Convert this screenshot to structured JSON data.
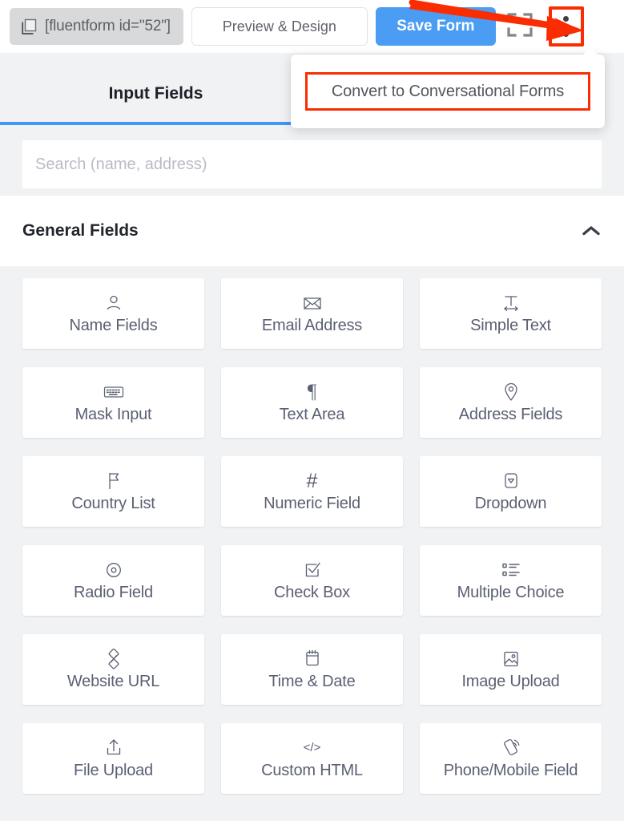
{
  "topbar": {
    "shortcode": "[fluentform id=\"52\"]",
    "copy_icon": "copy-icon",
    "preview_label": "Preview & Design",
    "save_label": "Save Form",
    "fullscreen_icon": "fullscreen-icon",
    "kebab_icon": "more-vertical-icon"
  },
  "dropdown": {
    "visible": true,
    "items": [
      {
        "label": "Convert to Conversational Forms",
        "highlighted": true
      }
    ]
  },
  "tabs": [
    {
      "label": "Input Fields",
      "active": true
    }
  ],
  "search": {
    "placeholder": "Search (name, address)",
    "value": ""
  },
  "section": {
    "title": "General Fields",
    "collapse_icon": "chevron-up-icon",
    "expanded": true
  },
  "fields": [
    {
      "label": "Name Fields",
      "icon": "user-icon"
    },
    {
      "label": "Email Address",
      "icon": "envelope-icon"
    },
    {
      "label": "Simple Text",
      "icon": "text-width-icon"
    },
    {
      "label": "Mask Input",
      "icon": "keyboard-icon"
    },
    {
      "label": "Text Area",
      "icon": "pilcrow-icon"
    },
    {
      "label": "Address Fields",
      "icon": "map-pin-icon"
    },
    {
      "label": "Country List",
      "icon": "flag-icon"
    },
    {
      "label": "Numeric Field",
      "icon": "hash-icon"
    },
    {
      "label": "Dropdown",
      "icon": "dropdown-caret-icon"
    },
    {
      "label": "Radio Field",
      "icon": "radio-circle-icon"
    },
    {
      "label": "Check Box",
      "icon": "checkbox-check-icon"
    },
    {
      "label": "Multiple Choice",
      "icon": "list-icon"
    },
    {
      "label": "Website URL",
      "icon": "link-icon"
    },
    {
      "label": "Time & Date",
      "icon": "calendar-icon"
    },
    {
      "label": "Image Upload",
      "icon": "image-icon"
    },
    {
      "label": "File Upload",
      "icon": "upload-icon"
    },
    {
      "label": "Custom HTML",
      "icon": "code-icon"
    },
    {
      "label": "Phone/Mobile Field",
      "icon": "phone-icon"
    }
  ],
  "annotations": {
    "arrow_color": "#fa2d02",
    "highlight_color": "#fa2d02",
    "arrow_icon": "red-pointer-arrow"
  },
  "colors": {
    "accent_blue": "#4a9df3",
    "tab_underline": "#3f97f6",
    "page_bg": "#f1f2f4",
    "card_text": "#5b6073"
  }
}
